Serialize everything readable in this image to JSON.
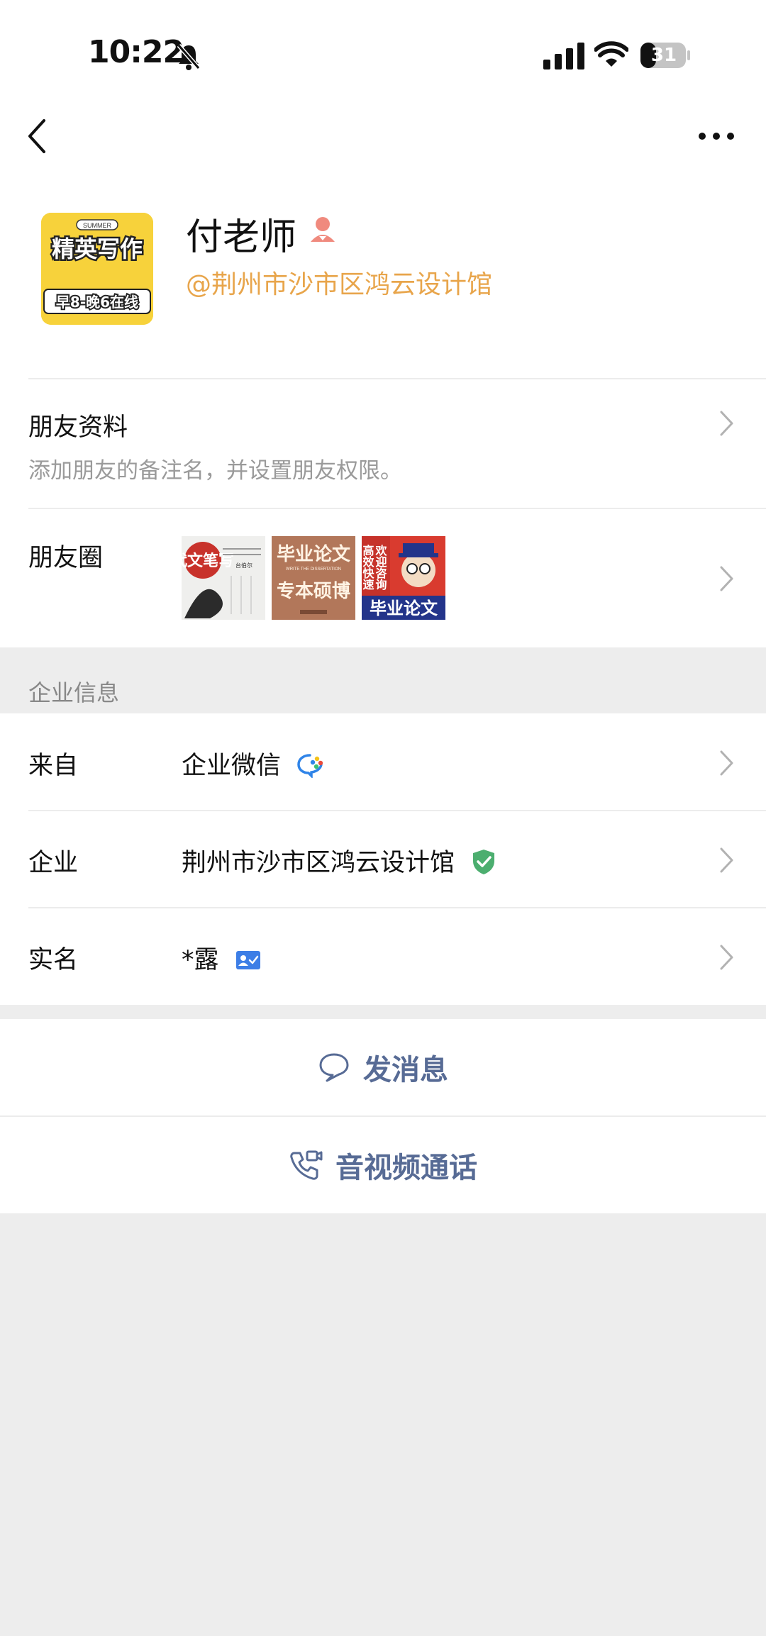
{
  "status_bar": {
    "time": "10:22",
    "battery": "31"
  },
  "profile": {
    "name": "付老师",
    "company_tag": "@荆州市沙市区鸿云设计馆",
    "avatar_text": {
      "top": "SUMMER",
      "main": "精英写作",
      "bottom": "早8-晚6在线"
    }
  },
  "friend_info": {
    "title": "朋友资料",
    "subtitle": "添加朋友的备注名，并设置朋友权限。"
  },
  "moments": {
    "title": "朋友圈",
    "thumbs": [
      {
        "text": "代文笔写",
        "caption": "台伯尔"
      },
      {
        "line1": "毕业论文",
        "line2": "专本硕博",
        "caption": "WRITE THE DISSERTATION"
      },
      {
        "side": "欢迎咨询",
        "side2": "高效快速",
        "bottom": "毕业论文"
      }
    ]
  },
  "enterprise": {
    "section_label": "企业信息",
    "from_label": "来自",
    "from_value": "企业微信",
    "company_label": "企业",
    "company_value": "荆州市沙市区鸿云设计馆",
    "realname_label": "实名",
    "realname_value": "*露"
  },
  "actions": {
    "message": "发消息",
    "call": "音视频通话"
  },
  "colors": {
    "accent_blue": "#576b95",
    "company_orange": "#e8a54b",
    "verified_green": "#4cae6f",
    "background": "#ededed"
  }
}
